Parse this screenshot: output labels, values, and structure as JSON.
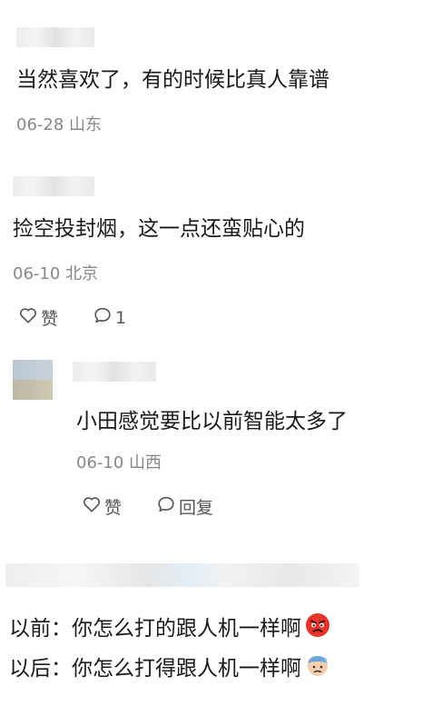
{
  "comments": [
    {
      "text": "当然喜欢了，有的时候比真人靠谱",
      "date": "06-28",
      "location": "山东"
    },
    {
      "text": "捡空投封烟，这一点还蛮贴心的",
      "date": "06-10",
      "location": "北京",
      "like_label": "赞",
      "reply_count": "1"
    },
    {
      "text": "小田感觉要比以前智能太多了",
      "date": "06-10",
      "location": "山西",
      "like_label": "赞",
      "reply_label": "回复"
    },
    {
      "lines": [
        {
          "text": "以前：你怎么打的跟人机一样啊",
          "emoji": "angry-face"
        },
        {
          "text": "以后：你怎么打得跟人机一样啊",
          "emoji": "anxious-face"
        }
      ]
    }
  ],
  "colors": {
    "text": "#1a1a1a",
    "meta": "#888888",
    "icon": "#555555"
  }
}
